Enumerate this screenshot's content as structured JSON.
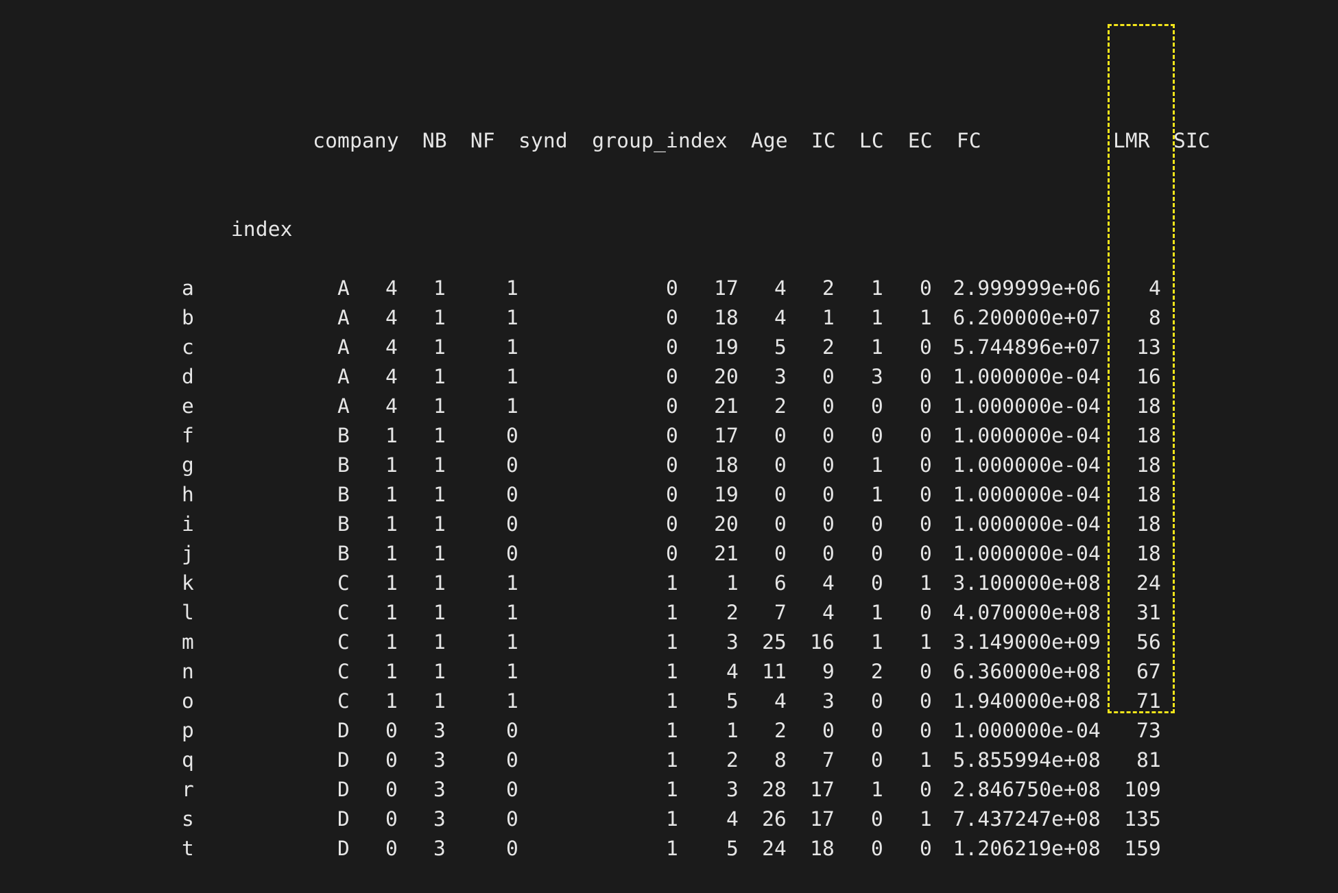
{
  "columns": [
    "company",
    "NB",
    "NF",
    "synd",
    "group_index",
    "Age",
    "IC",
    "LC",
    "EC",
    "FC",
    "LMR",
    "SIC"
  ],
  "index_name": "index",
  "rows": [
    {
      "index": "a",
      "company": "A",
      "NB": "4",
      "NF": "1",
      "synd": "1",
      "group_index": "0",
      "Age": "17",
      "IC": "4",
      "LC": "2",
      "EC": "1",
      "FC": "0",
      "LMR": "2.999999e+06",
      "SIC": "4"
    },
    {
      "index": "b",
      "company": "A",
      "NB": "4",
      "NF": "1",
      "synd": "1",
      "group_index": "0",
      "Age": "18",
      "IC": "4",
      "LC": "1",
      "EC": "1",
      "FC": "1",
      "LMR": "6.200000e+07",
      "SIC": "8"
    },
    {
      "index": "c",
      "company": "A",
      "NB": "4",
      "NF": "1",
      "synd": "1",
      "group_index": "0",
      "Age": "19",
      "IC": "5",
      "LC": "2",
      "EC": "1",
      "FC": "0",
      "LMR": "5.744896e+07",
      "SIC": "13"
    },
    {
      "index": "d",
      "company": "A",
      "NB": "4",
      "NF": "1",
      "synd": "1",
      "group_index": "0",
      "Age": "20",
      "IC": "3",
      "LC": "0",
      "EC": "3",
      "FC": "0",
      "LMR": "1.000000e-04",
      "SIC": "16"
    },
    {
      "index": "e",
      "company": "A",
      "NB": "4",
      "NF": "1",
      "synd": "1",
      "group_index": "0",
      "Age": "21",
      "IC": "2",
      "LC": "0",
      "EC": "0",
      "FC": "0",
      "LMR": "1.000000e-04",
      "SIC": "18"
    },
    {
      "index": "f",
      "company": "B",
      "NB": "1",
      "NF": "1",
      "synd": "0",
      "group_index": "0",
      "Age": "17",
      "IC": "0",
      "LC": "0",
      "EC": "0",
      "FC": "0",
      "LMR": "1.000000e-04",
      "SIC": "18"
    },
    {
      "index": "g",
      "company": "B",
      "NB": "1",
      "NF": "1",
      "synd": "0",
      "group_index": "0",
      "Age": "18",
      "IC": "0",
      "LC": "0",
      "EC": "1",
      "FC": "0",
      "LMR": "1.000000e-04",
      "SIC": "18"
    },
    {
      "index": "h",
      "company": "B",
      "NB": "1",
      "NF": "1",
      "synd": "0",
      "group_index": "0",
      "Age": "19",
      "IC": "0",
      "LC": "0",
      "EC": "1",
      "FC": "0",
      "LMR": "1.000000e-04",
      "SIC": "18"
    },
    {
      "index": "i",
      "company": "B",
      "NB": "1",
      "NF": "1",
      "synd": "0",
      "group_index": "0",
      "Age": "20",
      "IC": "0",
      "LC": "0",
      "EC": "0",
      "FC": "0",
      "LMR": "1.000000e-04",
      "SIC": "18"
    },
    {
      "index": "j",
      "company": "B",
      "NB": "1",
      "NF": "1",
      "synd": "0",
      "group_index": "0",
      "Age": "21",
      "IC": "0",
      "LC": "0",
      "EC": "0",
      "FC": "0",
      "LMR": "1.000000e-04",
      "SIC": "18"
    },
    {
      "index": "k",
      "company": "C",
      "NB": "1",
      "NF": "1",
      "synd": "1",
      "group_index": "1",
      "Age": "1",
      "IC": "6",
      "LC": "4",
      "EC": "0",
      "FC": "1",
      "LMR": "3.100000e+08",
      "SIC": "24"
    },
    {
      "index": "l",
      "company": "C",
      "NB": "1",
      "NF": "1",
      "synd": "1",
      "group_index": "1",
      "Age": "2",
      "IC": "7",
      "LC": "4",
      "EC": "1",
      "FC": "0",
      "LMR": "4.070000e+08",
      "SIC": "31"
    },
    {
      "index": "m",
      "company": "C",
      "NB": "1",
      "NF": "1",
      "synd": "1",
      "group_index": "1",
      "Age": "3",
      "IC": "25",
      "LC": "16",
      "EC": "1",
      "FC": "1",
      "LMR": "3.149000e+09",
      "SIC": "56"
    },
    {
      "index": "n",
      "company": "C",
      "NB": "1",
      "NF": "1",
      "synd": "1",
      "group_index": "1",
      "Age": "4",
      "IC": "11",
      "LC": "9",
      "EC": "2",
      "FC": "0",
      "LMR": "6.360000e+08",
      "SIC": "67"
    },
    {
      "index": "o",
      "company": "C",
      "NB": "1",
      "NF": "1",
      "synd": "1",
      "group_index": "1",
      "Age": "5",
      "IC": "4",
      "LC": "3",
      "EC": "0",
      "FC": "0",
      "LMR": "1.940000e+08",
      "SIC": "71"
    },
    {
      "index": "p",
      "company": "D",
      "NB": "0",
      "NF": "3",
      "synd": "0",
      "group_index": "1",
      "Age": "1",
      "IC": "2",
      "LC": "0",
      "EC": "0",
      "FC": "0",
      "LMR": "1.000000e-04",
      "SIC": "73"
    },
    {
      "index": "q",
      "company": "D",
      "NB": "0",
      "NF": "3",
      "synd": "0",
      "group_index": "1",
      "Age": "2",
      "IC": "8",
      "LC": "7",
      "EC": "0",
      "FC": "1",
      "LMR": "5.855994e+08",
      "SIC": "81"
    },
    {
      "index": "r",
      "company": "D",
      "NB": "0",
      "NF": "3",
      "synd": "0",
      "group_index": "1",
      "Age": "3",
      "IC": "28",
      "LC": "17",
      "EC": "1",
      "FC": "0",
      "LMR": "2.846750e+08",
      "SIC": "109"
    },
    {
      "index": "s",
      "company": "D",
      "NB": "0",
      "NF": "3",
      "synd": "0",
      "group_index": "1",
      "Age": "4",
      "IC": "26",
      "LC": "17",
      "EC": "0",
      "FC": "1",
      "LMR": "7.437247e+08",
      "SIC": "135"
    },
    {
      "index": "t",
      "company": "D",
      "NB": "0",
      "NF": "3",
      "synd": "0",
      "group_index": "1",
      "Age": "5",
      "IC": "24",
      "LC": "18",
      "EC": "0",
      "FC": "0",
      "LMR": "1.206219e+08",
      "SIC": "159"
    }
  ],
  "colors": {
    "background": "#1b1b1b",
    "text": "#e6e6e6",
    "highlight": "#f2e41a"
  }
}
